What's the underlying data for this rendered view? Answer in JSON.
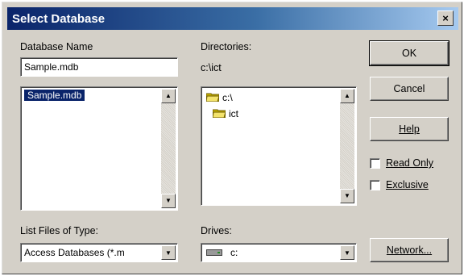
{
  "window": {
    "title": "Select Database",
    "close_label": "×"
  },
  "database_name": {
    "label": "Database Name",
    "value": "Sample.mdb"
  },
  "file_list": {
    "items": [
      "Sample.mdb"
    ],
    "selected_index": 0
  },
  "directories": {
    "label": "Directories:",
    "current_path": "c:\\ict",
    "items": [
      "c:\\",
      "ict"
    ]
  },
  "list_files_type": {
    "label": "List Files of Type:",
    "value": "Access Databases (*.m"
  },
  "drives": {
    "label": "Drives:",
    "value": "c:"
  },
  "buttons": {
    "ok": "OK",
    "cancel": "Cancel",
    "help": "Help",
    "network": "Network..."
  },
  "options": {
    "read_only": {
      "label": "Read Only",
      "checked": false
    },
    "exclusive": {
      "label": "Exclusive",
      "checked": false
    }
  },
  "icons": {
    "folder": "folder-icon",
    "drive": "drive-icon",
    "scroll_up": "scroll-up-arrow-icon",
    "scroll_down": "scroll-down-arrow-icon",
    "dropdown": "dropdown-arrow-icon"
  },
  "colors": {
    "title_start": "#0a246a",
    "title_end": "#a6caf0",
    "selection": "#0a246a",
    "face": "#d4d0c8"
  }
}
